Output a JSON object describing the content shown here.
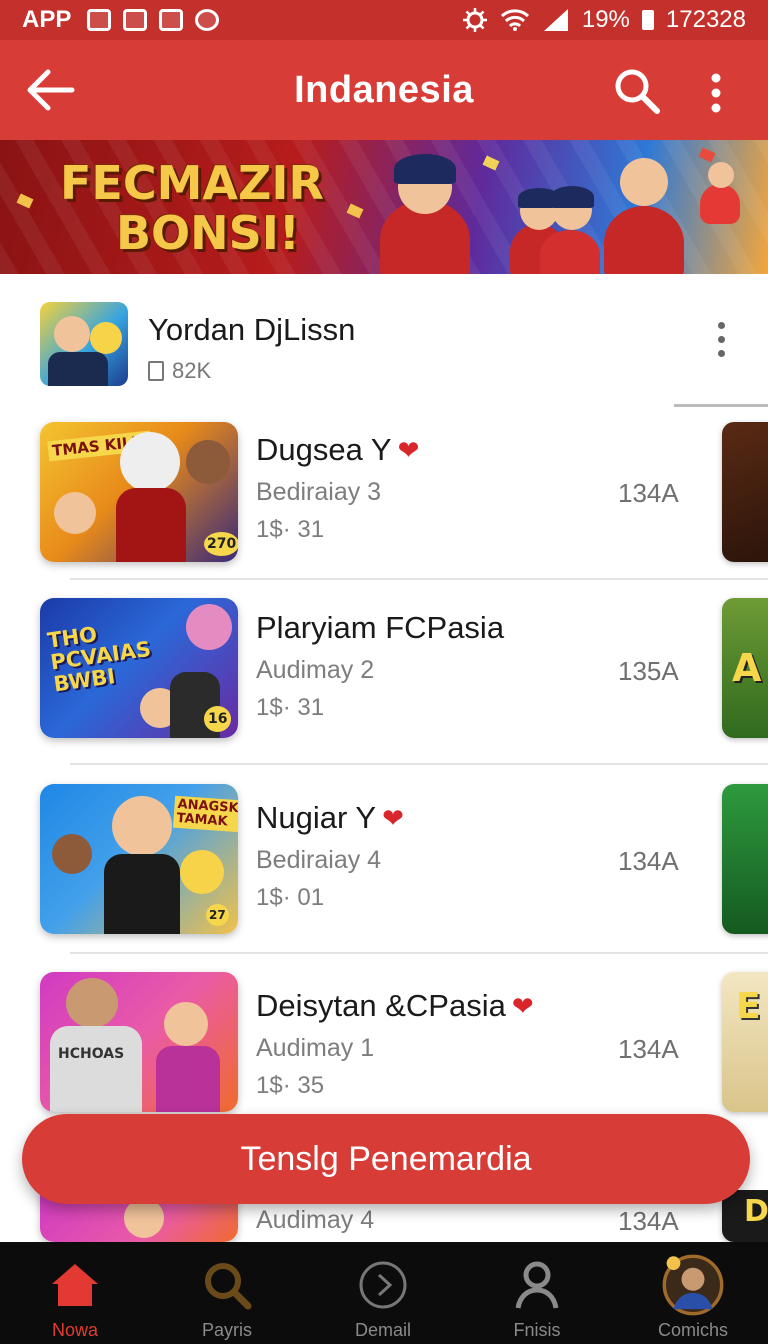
{
  "status_bar": {
    "app_label": "APP",
    "battery": "19%",
    "time": "172328"
  },
  "app_bar": {
    "title": "Indanesia"
  },
  "banner": {
    "promo_line1": "FECMAZIR",
    "promo_line2": "BONSI!"
  },
  "featured": {
    "name": "Yordan DjLissn",
    "downloads": "82K"
  },
  "items": [
    {
      "title": "Dugsea Y",
      "heart": true,
      "subtitle": "Bediraiay 3",
      "price": "1$· 31",
      "meta": "134A",
      "art_text": "TMAS KILLI",
      "art_badge": "270"
    },
    {
      "title": "Plaryiam FCPasia",
      "heart": false,
      "subtitle": "Audimay 2",
      "price": "1$· 31",
      "meta": "135A",
      "art_text": "THO PCVAIAS BWBI",
      "art_badge": "16",
      "peek_text": "A"
    },
    {
      "title": "Nugiar Y",
      "heart": true,
      "subtitle": "Bediraiay 4",
      "price": "1$· 01",
      "meta": "134A",
      "art_text": "ANAGSK TAMAK",
      "art_badge": "27"
    },
    {
      "title": "Deisytan &CPasia",
      "heart": true,
      "subtitle": "Audimay 1",
      "price": "1$· 35",
      "meta": "134A",
      "art_text": "HCHOAS",
      "peek_text": "E"
    },
    {
      "title": "",
      "heart": false,
      "subtitle": "Audimay 4",
      "price": "",
      "meta": "134A",
      "peek_text": "D"
    }
  ],
  "cta": {
    "label": "Tenslg Penemardia"
  },
  "bottom_nav": [
    {
      "label": "Nowa",
      "icon": "home-icon",
      "active": true
    },
    {
      "label": "Payris",
      "icon": "search-icon",
      "active": false
    },
    {
      "label": "Demail",
      "icon": "play-circle-icon",
      "active": false
    },
    {
      "label": "Fnisis",
      "icon": "person-icon",
      "active": false
    },
    {
      "label": "Comichs",
      "icon": "avatar-icon",
      "active": false
    }
  ],
  "colors": {
    "primary": "#d83c37",
    "status_bar": "#c4302b",
    "nav_background": "#0c0c0c",
    "nav_active": "#e23a33",
    "heart": "#d9262b"
  }
}
